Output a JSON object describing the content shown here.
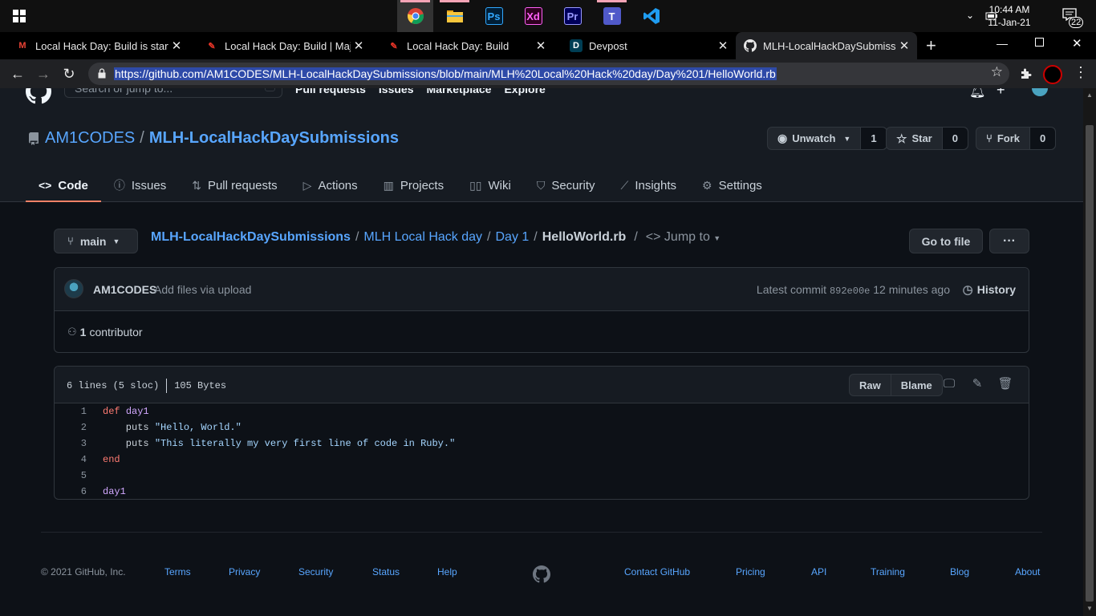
{
  "taskbar": {
    "apps": [
      {
        "name": "chrome"
      },
      {
        "name": "file-explorer"
      },
      {
        "name": "photoshop",
        "glyph": "Ps"
      },
      {
        "name": "adobe-xd",
        "glyph": "Xd"
      },
      {
        "name": "premiere-pro",
        "glyph": "Pr"
      },
      {
        "name": "teams",
        "glyph": "T"
      },
      {
        "name": "vscode",
        "glyph": "⟩"
      }
    ],
    "time": "10:44 AM",
    "date": "11-Jan-21",
    "notifications": "22"
  },
  "browser": {
    "tabs": [
      {
        "title": "Local Hack Day: Build is starting",
        "icon": "gmail-icon",
        "glyph": "M"
      },
      {
        "title": "Local Hack Day: Build | Major L",
        "icon": "mlh-icon",
        "glyph": "✎"
      },
      {
        "title": "Local Hack Day: Build",
        "icon": "mlh-icon",
        "glyph": "✎"
      },
      {
        "title": "Devpost",
        "icon": "devpost-icon",
        "glyph": "D"
      },
      {
        "title": "MLH-LocalHackDaySubmission",
        "icon": "github-icon",
        "glyph": "●"
      }
    ],
    "new_tab": "+",
    "url": "https://github.com/AM1CODES/MLH-LocalHackDaySubmissions/blob/main/MLH%20Local%20Hack%20day/Day%201/HelloWorld.rb"
  },
  "gh_header": {
    "search_placeholder": "Search or jump to...",
    "slash": "/",
    "links": [
      "Pull requests",
      "Issues",
      "Marketplace",
      "Explore"
    ]
  },
  "repo": {
    "owner": "AM1CODES",
    "name": "MLH-LocalHackDaySubmissions",
    "unwatch_label": "Unwatch",
    "watch_count": "1",
    "star_label": "Star",
    "star_count": "0",
    "fork_label": "Fork",
    "fork_count": "0",
    "nav": [
      "Code",
      "Issues",
      "Pull requests",
      "Actions",
      "Projects",
      "Wiki",
      "Security",
      "Insights",
      "Settings"
    ]
  },
  "file": {
    "branch": "main",
    "crumbs": [
      "MLH-LocalHackDaySubmissions",
      "MLH Local Hack day",
      "Day 1"
    ],
    "filename": "HelloWorld.rb",
    "jump_to": "Jump to",
    "goto_label": "Go to file",
    "more_label": "···",
    "commit_author": "AM1CODES",
    "commit_message": "Add files via upload",
    "latest_commit_label": "Latest commit",
    "commit_sha": "892e00e",
    "commit_time": "12 minutes ago",
    "history_label": "History",
    "contributors_count": "1",
    "contributors_label": "contributor",
    "lines_info": "6 lines (5 sloc)",
    "size_info": "105 Bytes",
    "raw_label": "Raw",
    "blame_label": "Blame",
    "code_lines": [
      {
        "num": "1",
        "text": "def day1"
      },
      {
        "num": "2",
        "text": "    puts \"Hello, World.\""
      },
      {
        "num": "3",
        "text": "    puts \"This literally my very first line of code in Ruby.\""
      },
      {
        "num": "4",
        "text": "end"
      },
      {
        "num": "5",
        "text": ""
      },
      {
        "num": "6",
        "text": "day1"
      }
    ]
  },
  "footer": {
    "copyright": "© 2021 GitHub, Inc.",
    "left_links": [
      "Terms",
      "Privacy",
      "Security",
      "Status",
      "Help"
    ],
    "right_links": [
      "Contact GitHub",
      "Pricing",
      "API",
      "Training",
      "Blog",
      "About"
    ]
  },
  "colors": {
    "background": "#0d1117",
    "header_bg": "#161b22",
    "link": "#58a6ff",
    "tab_underline": "#f78166",
    "keyword": "#ff7b72",
    "function": "#d2a8ff",
    "string": "#a5d6ff"
  }
}
